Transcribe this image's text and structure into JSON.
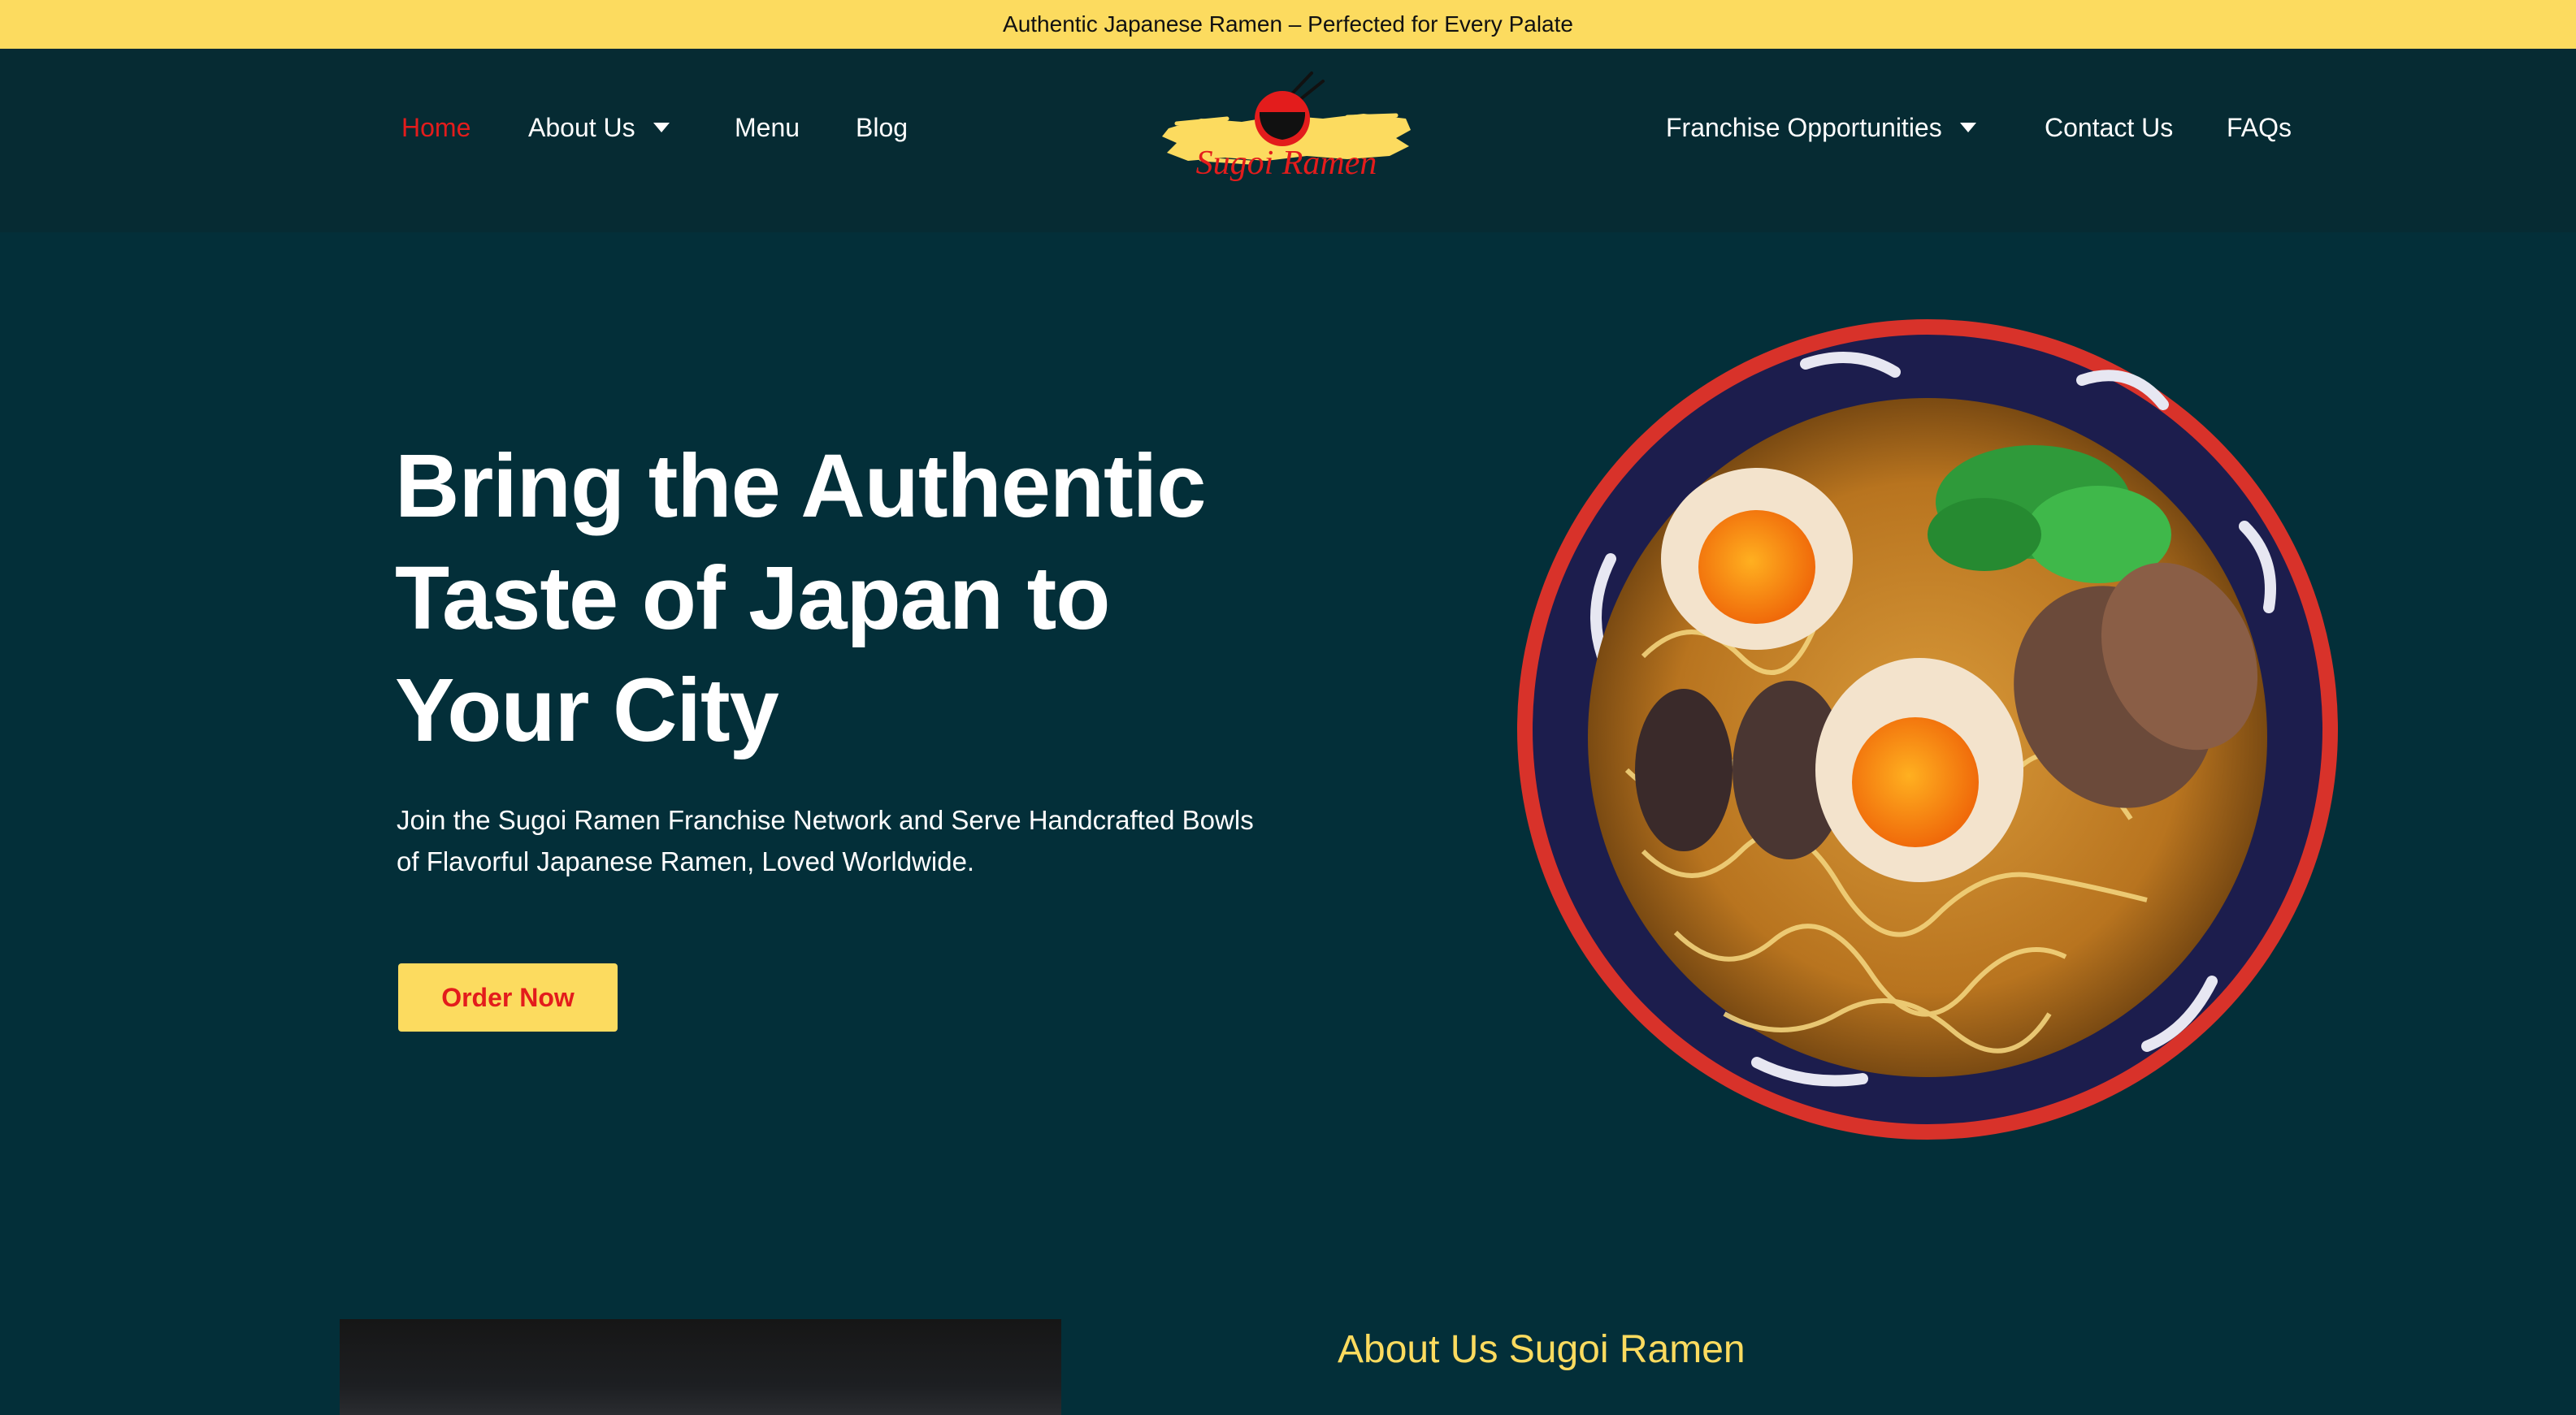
{
  "announcement": {
    "text": "Authentic Japanese Ramen – Perfected for Every Palate"
  },
  "colors": {
    "accent_yellow": "#fcdb5f",
    "accent_red": "#e31c1c",
    "background": "#032f39",
    "nav_background": "#062b33"
  },
  "nav": {
    "left": [
      {
        "label": "Home",
        "active": true
      },
      {
        "label": "About Us",
        "has_dropdown": true
      },
      {
        "label": "Menu"
      },
      {
        "label": "Blog"
      }
    ],
    "right": [
      {
        "label": "Franchise Opportunities",
        "has_dropdown": true
      },
      {
        "label": "Contact Us"
      },
      {
        "label": "FAQs"
      }
    ],
    "logo": {
      "text": "Sugoi Ramen",
      "icon": "ramen-bowl-chopsticks-icon"
    }
  },
  "hero": {
    "title_line1": "Bring the Authentic",
    "title_line2": "Taste of Japan to",
    "title_line3": "Your City",
    "subtitle_line1": "Join the Sugoi Ramen Franchise Network and Serve Handcrafted Bowls",
    "subtitle_line2": "of Flavorful Japanese Ramen, Loved Worldwide.",
    "cta_label": "Order Now"
  },
  "about": {
    "heading": "About Us Sugoi Ramen"
  }
}
